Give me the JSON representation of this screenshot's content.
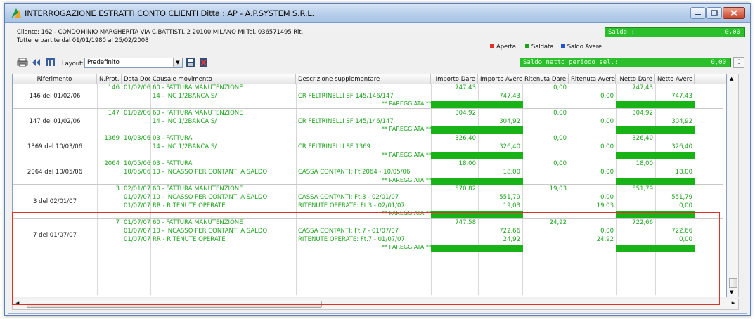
{
  "window": {
    "title": "INTERROGAZIONE ESTRATTI CONTO CLIENTI  Ditta : AP - A.P.SYSTEM S.R.L."
  },
  "info": {
    "cliente": "Cliente: 162 - CONDOMINIO MARGHERITA  VIA C.BATTISTI, 2  20100 MILANO  MI  Tel. 036571495 Rit.:",
    "periodo": "Tutte le partite dal 01/01/1980 al 25/02/2008",
    "saldo_label": "Saldo :",
    "saldo_value": "0,00",
    "saldo_netto_label": "Saldo netto periodo sel.:",
    "saldo_netto_value": "0,00"
  },
  "legend": {
    "aperta": "Aperta",
    "saldata": "Saldata",
    "saldo_avere": "Saldo Avere",
    "colors": {
      "aperta": "#e0302a",
      "saldata": "#1ea21e",
      "saldo_avere": "#2255cc"
    }
  },
  "toolbar": {
    "layout_label": "Layout:",
    "layout_value": "Predefinito",
    "icons": [
      "printer-icon",
      "filter-icon",
      "columns-icon",
      "save-layout-icon",
      "delete-layout-icon"
    ]
  },
  "columns": [
    "Riferimento",
    "N.Prot.",
    "Data Doc.",
    "Causale movimento",
    "Descrizione supplementare",
    "Importo Dare",
    "Importo Avere",
    "Ritenuta Dare",
    "Ritenuta Avere",
    "Netto Dare",
    "Netto Avere"
  ],
  "pareggiata": "** PAREGGIATA **",
  "groups": [
    {
      "ref": "146 del 01/02/06",
      "rows": [
        {
          "nprot": "146",
          "data": "01/02/06",
          "causale": "60 - FATTURA MANUTENZIONE",
          "descr": "",
          "idare": "747,43",
          "iavere": "",
          "rdare": "0,00",
          "ravere": "",
          "ndare": "747,43",
          "navere": ""
        },
        {
          "nprot": "",
          "data": "",
          "causale": "14 - INC 1/2BANCA S/",
          "descr": "CR FELTRINELLI SF 145/146/147",
          "idare": "",
          "iavere": "747,43",
          "rdare": "",
          "ravere": "0,00",
          "ndare": "",
          "navere": "747,43"
        }
      ]
    },
    {
      "ref": "147 del 01/02/06",
      "rows": [
        {
          "nprot": "147",
          "data": "01/02/06",
          "causale": "60 - FATTURA MANUTENZIONE",
          "descr": "",
          "idare": "304,92",
          "iavere": "",
          "rdare": "0,00",
          "ravere": "",
          "ndare": "304,92",
          "navere": ""
        },
        {
          "nprot": "",
          "data": "",
          "causale": "14 - INC 1/2BANCA S/",
          "descr": "CR FELTRINELLI SF 145/146/147",
          "idare": "",
          "iavere": "304,92",
          "rdare": "",
          "ravere": "0,00",
          "ndare": "",
          "navere": "304,92"
        }
      ]
    },
    {
      "ref": "1369 del 10/03/06",
      "rows": [
        {
          "nprot": "1369",
          "data": "10/03/06",
          "causale": "03 - FATTURA",
          "descr": "",
          "idare": "326,40",
          "iavere": "",
          "rdare": "0,00",
          "ravere": "",
          "ndare": "326,40",
          "navere": ""
        },
        {
          "nprot": "",
          "data": "",
          "causale": "14 - INC 1/2BANCA S/",
          "descr": "CR FELTRINELLI SF 1369",
          "idare": "",
          "iavere": "326,40",
          "rdare": "",
          "ravere": "0,00",
          "ndare": "",
          "navere": "326,40"
        }
      ]
    },
    {
      "ref": "2064 del 10/05/06",
      "rows": [
        {
          "nprot": "2064",
          "data": "10/05/06",
          "causale": "03 - FATTURA",
          "descr": "",
          "idare": "18,00",
          "iavere": "",
          "rdare": "0,00",
          "ravere": "",
          "ndare": "18,00",
          "navere": ""
        },
        {
          "nprot": "",
          "data": "10/05/06",
          "causale": "10 - INCASSO PER CONTANTI A SALDO",
          "descr": "CASSA CONTANTI: Ft.2064 - 10/05/06",
          "idare": "",
          "iavere": "18,00",
          "rdare": "",
          "ravere": "0,00",
          "ndare": "",
          "navere": "18,00"
        }
      ]
    },
    {
      "ref": "3 del 02/01/07",
      "rows": [
        {
          "nprot": "3",
          "data": "02/01/07",
          "causale": "60 - FATTURA MANUTENZIONE",
          "descr": "",
          "idare": "570,82",
          "iavere": "",
          "rdare": "19,03",
          "ravere": "",
          "ndare": "551,79",
          "navere": ""
        },
        {
          "nprot": "",
          "data": "01/07/07",
          "causale": "10 - INCASSO PER CONTANTI A SALDO",
          "descr": "CASSA CONTANTI: Ft.3 - 02/01/07",
          "idare": "",
          "iavere": "551,79",
          "rdare": "",
          "ravere": "0,00",
          "ndare": "",
          "navere": "551,79"
        },
        {
          "nprot": "",
          "data": "01/07/07",
          "causale": "RR - RITENUTE OPERATE",
          "descr": "RITENUTE OPERATE: Ft.3 - 02/01/07",
          "idare": "",
          "iavere": "19,03",
          "rdare": "",
          "ravere": "19,03",
          "ndare": "",
          "navere": "0,00"
        }
      ]
    },
    {
      "ref": "7 del 01/07/07",
      "rows": [
        {
          "nprot": "7",
          "data": "01/07/07",
          "causale": "60 - FATTURA MANUTENZIONE",
          "descr": "",
          "idare": "747,58",
          "iavere": "",
          "rdare": "24,92",
          "ravere": "",
          "ndare": "722,66",
          "navere": ""
        },
        {
          "nprot": "",
          "data": "01/07/07",
          "causale": "10 - INCASSO PER CONTANTI A SALDO",
          "descr": "CASSA CONTANTI: Ft.7 - 01/07/07",
          "idare": "",
          "iavere": "722,66",
          "rdare": "",
          "ravere": "0,00",
          "ndare": "",
          "navere": "722,66"
        },
        {
          "nprot": "",
          "data": "01/07/07",
          "causale": "RR - RITENUTE OPERATE",
          "descr": "RITENUTE OPERATE: Ft.7 - 01/07/07",
          "idare": "",
          "iavere": "24,92",
          "rdare": "",
          "ravere": "24,92",
          "ndare": "",
          "navere": "0,00"
        }
      ]
    }
  ]
}
